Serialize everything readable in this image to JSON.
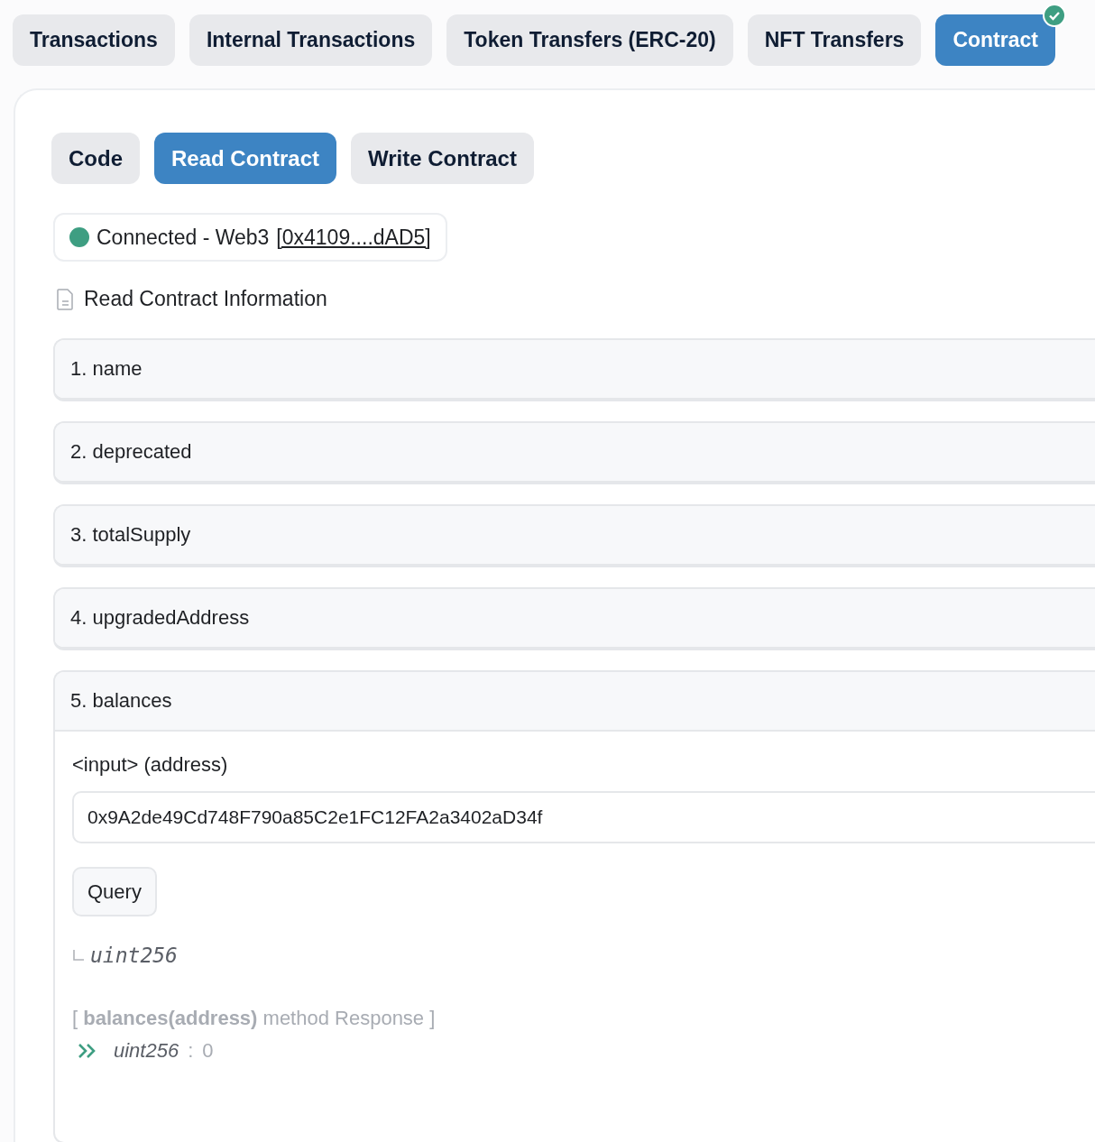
{
  "tabs": [
    {
      "label": "Transactions",
      "selected": false,
      "verified": false
    },
    {
      "label": "Internal Transactions",
      "selected": false,
      "verified": false
    },
    {
      "label": "Token Transfers (ERC-20)",
      "selected": false,
      "verified": false
    },
    {
      "label": "NFT Transfers",
      "selected": false,
      "verified": false
    },
    {
      "label": "Contract",
      "selected": true,
      "verified": true
    }
  ],
  "subtabs": [
    {
      "label": "Code",
      "selected": false
    },
    {
      "label": "Read Contract",
      "selected": true
    },
    {
      "label": "Write Contract",
      "selected": false
    }
  ],
  "connection": {
    "connected": true,
    "status": "Connected - Web3",
    "address": "[0x4109....dAD5]"
  },
  "section_title": "Read Contract Information",
  "functions": [
    {
      "label": "1. name",
      "expanded": false
    },
    {
      "label": "2. deprecated",
      "expanded": false
    },
    {
      "label": "3. totalSupply",
      "expanded": false
    },
    {
      "label": "4. upgradedAddress",
      "expanded": false
    },
    {
      "label": "5. balances",
      "expanded": true,
      "input_label": "<input> (address)",
      "input_value": "0x9A2de49Cd748F790a85C2e1FC12FA2a3402aD34f",
      "button": "Query",
      "output_type": "uint256",
      "response": {
        "header": "[ **balances(address)** method Response ]",
        "type": "uint256",
        "separator": ":",
        "value": "0"
      }
    }
  ]
}
